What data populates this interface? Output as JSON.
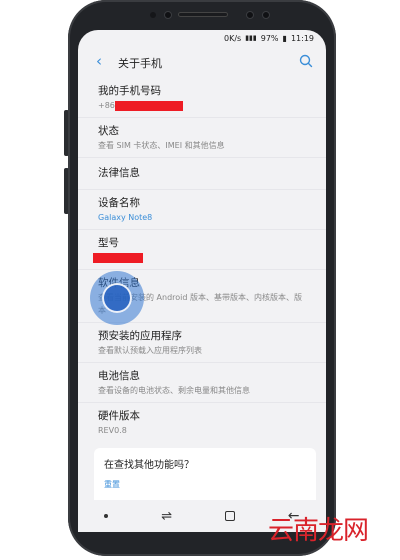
{
  "statusbar": {
    "speed": "0K/s",
    "battery": "97%",
    "time": "11:19"
  },
  "appbar": {
    "back_icon": "back-chevron-icon",
    "title": "关于手机",
    "search_icon": "search-icon"
  },
  "items": [
    {
      "title": "我的手机号码",
      "sub": "+86"
    },
    {
      "title": "状态",
      "sub": "查看 SIM 卡状态、IMEI 和其他信息"
    },
    {
      "title": "法律信息",
      "sub": ""
    },
    {
      "title": "设备名称",
      "sub": "Galaxy Note8"
    },
    {
      "title": "型号",
      "sub": ""
    },
    {
      "title": "软件信息",
      "sub": "查看当前安装的 Android 版本、基带版本、内核版本、版"
    },
    {
      "title": "预安装的应用程序",
      "sub": "查看默认预载入应用程序列表"
    },
    {
      "title": "电池信息",
      "sub": "查看设备的电池状态、剩余电量和其他信息"
    },
    {
      "title": "硬件版本",
      "sub": "REV0.8"
    }
  ],
  "card": {
    "title": "在查找其他功能吗？",
    "link": "重置"
  },
  "watermark": "云南龙网",
  "colors": {
    "accent": "#3b8ed8",
    "redaction": "#ee1c24"
  }
}
